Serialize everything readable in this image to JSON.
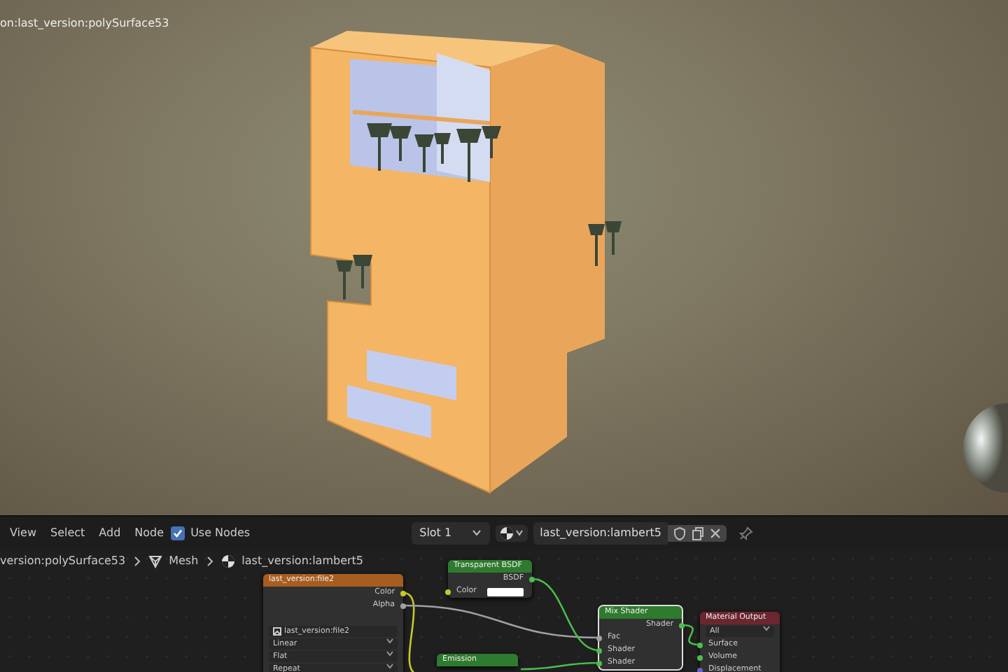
{
  "viewport": {
    "object_label": "on:last_version:polySurface53"
  },
  "header": {
    "menus": [
      "View",
      "Select",
      "Add",
      "Node"
    ],
    "use_nodes": {
      "label": "Use Nodes",
      "checked": true
    },
    "slot": "Slot 1",
    "material": "last_version:lambert5"
  },
  "breadcrumb": [
    {
      "label": "version:polySurface53"
    },
    {
      "kind": "mesh",
      "label": "Mesh"
    },
    {
      "kind": "material",
      "label": "last_version:lambert5"
    }
  ],
  "nodes": [
    {
      "kind": "image",
      "title": "last_version:file2",
      "outputs": [
        {
          "label": "Color",
          "color": "#c7c729"
        },
        {
          "label": "Alpha",
          "color": "#a1a1a1"
        }
      ],
      "image": "last_version:file2",
      "options": [
        "Linear",
        "Flat",
        "Repeat"
      ]
    },
    {
      "kind": "transparent",
      "title": "Transparent BSDF",
      "outputs": [
        {
          "label": "BSDF",
          "color": "#4dbd4d"
        }
      ],
      "inputs": [
        {
          "label": "Color",
          "color": "#c7c729",
          "swatch": {
            "color": "#ffffff"
          }
        }
      ]
    },
    {
      "kind": "emission",
      "title": "Emission"
    },
    {
      "kind": "mix",
      "title": "Mix Shader",
      "outputs": [
        {
          "label": "Shader",
          "color": "#4dbd4d"
        }
      ],
      "inputs": [
        {
          "label": "Fac",
          "color": "#a1a1a1"
        },
        {
          "label": "Shader",
          "color": "#4dbd4d"
        },
        {
          "label": "Shader",
          "color": "#4dbd4d"
        }
      ]
    },
    {
      "kind": "output",
      "title": "Material Output",
      "options": [
        "All"
      ],
      "inputs": [
        {
          "label": "Surface",
          "color": "#4dbd4d"
        },
        {
          "label": "Volume",
          "color": "#4dbd4d"
        },
        {
          "label": "Displacement",
          "color": "#6363c7"
        }
      ]
    }
  ]
}
